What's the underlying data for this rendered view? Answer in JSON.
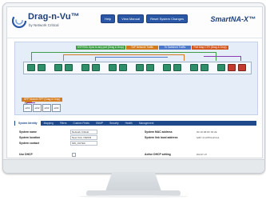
{
  "header": {
    "logo_title": "Drag-n-Vu™",
    "logo_subtitle": "by Network Critical",
    "nav": [
      "Help",
      "View Manual",
      "Reset System Changes"
    ],
    "brand": "SmartNA-X™"
  },
  "diagram": {
    "segments": [
      {
        "label": "NTP/SSL Sync to any port (Drag & Drop)",
        "color": "#3e9f47"
      },
      {
        "label": "TAP Network Traffic",
        "color": "#d27b1f"
      },
      {
        "label": "To Switched Traffic",
        "color": "#4d78c9"
      },
      {
        "label": "Port Map CTR (Drag & Drop)",
        "color": "#d2571f"
      }
    ],
    "ports": [
      "1",
      "2",
      "3",
      "4",
      "5",
      "6",
      "7",
      "8",
      "9",
      "10",
      "11",
      "12",
      "13",
      "14",
      "15",
      "16",
      "17",
      "18"
    ],
    "submodule_title": "SFP Module SFP (Drag & Drop)",
    "submodule_ports": [
      "eth1",
      "eth2",
      "eth3",
      "eth4"
    ]
  },
  "tabs": [
    "System Identity",
    "Mapping",
    "Filters",
    "Custom Fields",
    "SNMP",
    "Security",
    "Health",
    "Management"
  ],
  "form": {
    "system_name_label": "System name",
    "system_name_value": "Network Critical",
    "system_location_label": "System location",
    "system_location_value": "New York, NW/FR",
    "system_contact_label": "System contact",
    "system_contact_value": "NW_NCTEC",
    "mac_label": "System MAC address",
    "mac_value": "00:1D:08:DF:00:2E",
    "link_local_label": "System link local address",
    "link_local_value": "fe80::21d:8ff:fedf:2e4",
    "dhcp_label": "Use DHCP",
    "dhcp_status_label": "Active DHCP setting",
    "dhcp_status_value": "DHCP off"
  }
}
